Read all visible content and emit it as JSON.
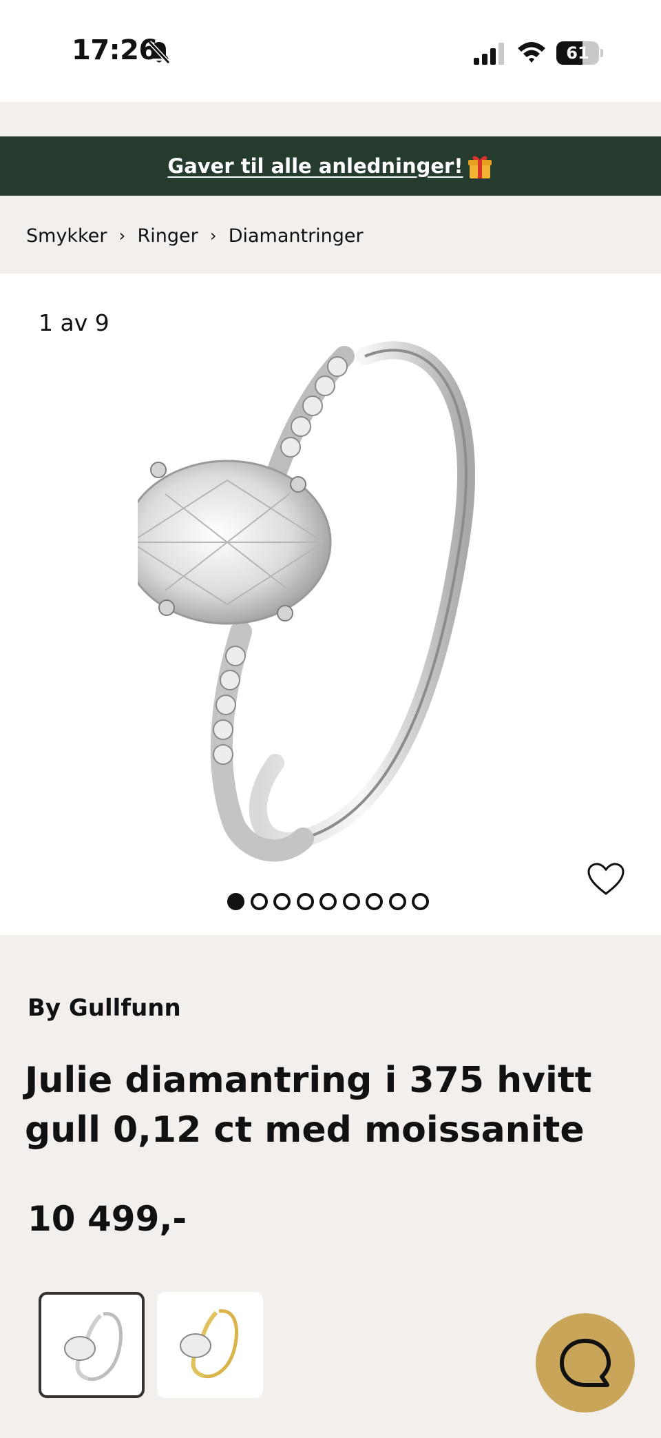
{
  "status_bar": {
    "time": "17:26",
    "battery": "61",
    "battery_level": 0.61,
    "icons": [
      "bell-slash-icon",
      "signal-icon",
      "wifi-icon",
      "battery-icon"
    ]
  },
  "promo": {
    "text": "Gaver til alle anledninger!",
    "icon": "gift-icon"
  },
  "breadcrumb": {
    "items": [
      "Smykker",
      "Ringer",
      "Diamantringer"
    ],
    "separator": "›"
  },
  "gallery": {
    "counter": "1 av 9",
    "total_slides": 9,
    "active_slide": 1
  },
  "product": {
    "brand": "By Gullfunn",
    "title": "Julie diamantring i 375 hvitt gull 0,12 ct med moissanite",
    "price": "10 499,-"
  },
  "variants": [
    {
      "name": "white-gold",
      "selected": true
    },
    {
      "name": "yellow-gold",
      "selected": false
    }
  ],
  "colors": {
    "banner_bg": "#243b2d",
    "page_bg": "#f2efec",
    "chat_button": "#c9a559"
  }
}
